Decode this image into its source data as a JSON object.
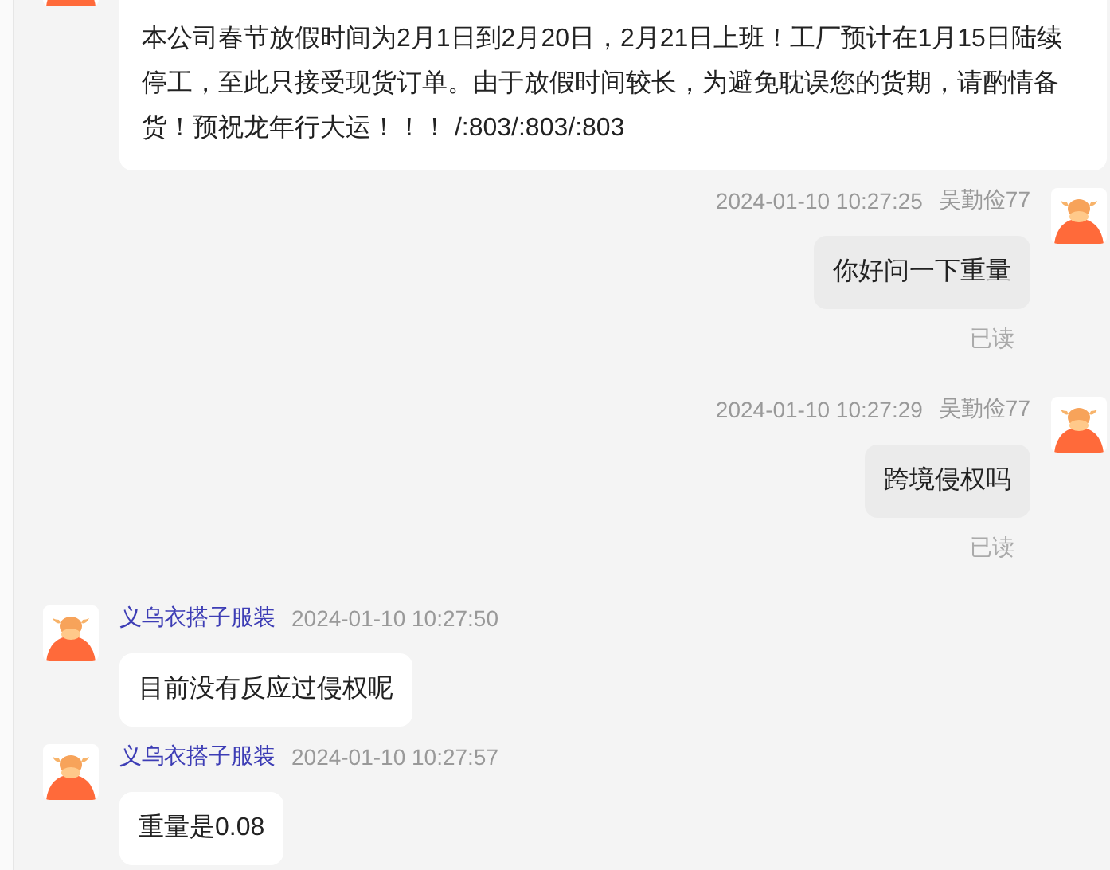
{
  "messages": [
    {
      "outgoing": false,
      "text": "本公司春节放假时间为2月1日到2月20日，2月21日上班！工厂预计在1月15日陆续停工，至此只接受现货订单。由于放假时间较长，为避免耽误您的货期，请酌情备货！预祝龙年行大运！！！ /:803/:803/:803"
    },
    {
      "outgoing": true,
      "time": "2024-01-10 10:27:25",
      "sender": "吴勤俭77",
      "text": "你好问一下重量",
      "status": "已读"
    },
    {
      "outgoing": true,
      "time": "2024-01-10 10:27:29",
      "sender": "吴勤俭77",
      "text": "跨境侵权吗",
      "status": "已读"
    },
    {
      "outgoing": false,
      "sender": "义乌衣搭子服装",
      "time": "2024-01-10 10:27:50",
      "text": "目前没有反应过侵权呢"
    },
    {
      "outgoing": false,
      "sender": "义乌衣搭子服装",
      "time": "2024-01-10 10:27:57",
      "text": "重量是0.08"
    }
  ]
}
